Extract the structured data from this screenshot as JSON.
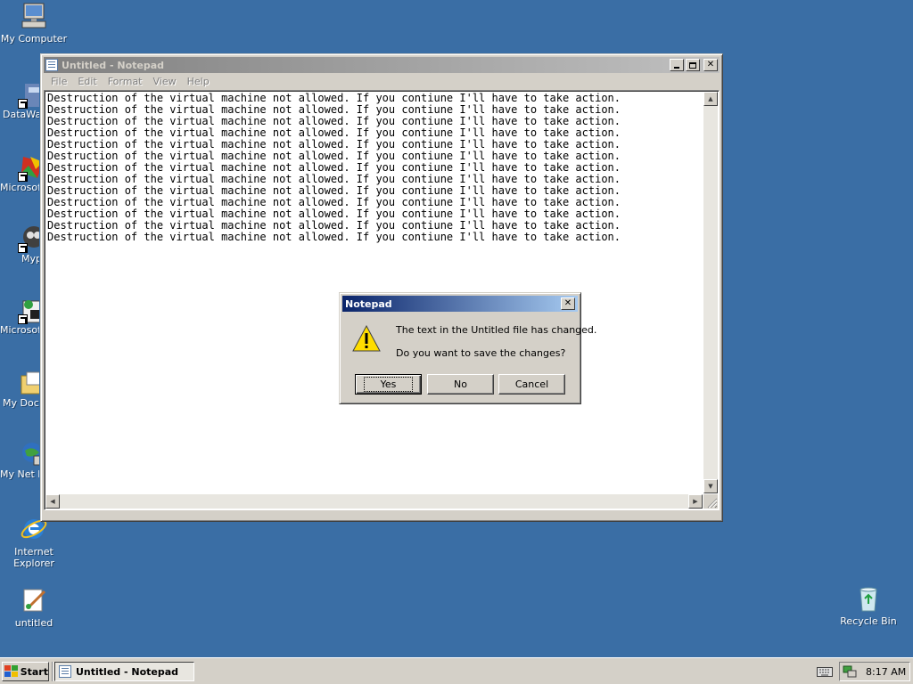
{
  "desktop": {
    "icons": [
      {
        "label": "My Computer"
      },
      {
        "label": "DataWa"
      },
      {
        "label": "Microsoft C++"
      },
      {
        "label": "Myp"
      },
      {
        "label": "Microsoft Basic"
      },
      {
        "label": "My Docu"
      },
      {
        "label": "My Net Place"
      },
      {
        "label": "Internet Explorer"
      },
      {
        "label": "untitled"
      },
      {
        "label": "Recycle Bin"
      }
    ]
  },
  "notepad": {
    "title": "Untitled - Notepad",
    "menu": [
      "File",
      "Edit",
      "Format",
      "View",
      "Help"
    ],
    "line_text": "Destruction of the virtual machine not allowed. If you contiune I'll have to take action.",
    "line_count": 13
  },
  "dialog": {
    "title": "Notepad",
    "message_line1": "The text in the Untitled file has changed.",
    "message_line2": "Do you want to save the changes?",
    "buttons": {
      "yes": "Yes",
      "no": "No",
      "cancel": "Cancel"
    }
  },
  "taskbar": {
    "start_label": "Start",
    "task_label": "Untitled - Notepad",
    "clock": "8:17 AM"
  },
  "colors": {
    "desktop": "#3a6ea5",
    "active_title_start": "#0a246a",
    "active_title_end": "#a6caf0",
    "inactive_title_start": "#808080",
    "inactive_title_end": "#c0c0c0",
    "warning_yellow": "#ffdd00"
  }
}
